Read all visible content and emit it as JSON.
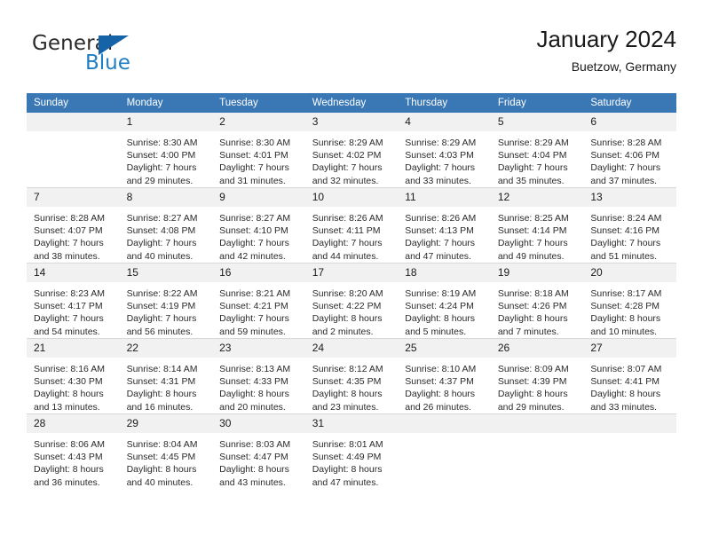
{
  "logo": {
    "word_top": "General",
    "word_bottom": "Blue",
    "accent_color": "#1763a8",
    "text_color": "#2b2b2b",
    "blue_text_color": "#1f7ec4"
  },
  "header": {
    "title": "January 2024",
    "subtitle": "Buetzow, Germany",
    "header_bg": "#3a77b5",
    "daynum_bg": "#f1f1f1"
  },
  "weekdays": [
    "Sunday",
    "Monday",
    "Tuesday",
    "Wednesday",
    "Thursday",
    "Friday",
    "Saturday"
  ],
  "labels": {
    "sunrise": "Sunrise:",
    "sunset": "Sunset:",
    "daylight": "Daylight:"
  },
  "weeks": [
    [
      {
        "day": "",
        "blank": true
      },
      {
        "day": "1",
        "l1": "Sunrise: 8:30 AM",
        "l2": "Sunset: 4:00 PM",
        "l3": "Daylight: 7 hours",
        "l4": "and 29 minutes."
      },
      {
        "day": "2",
        "l1": "Sunrise: 8:30 AM",
        "l2": "Sunset: 4:01 PM",
        "l3": "Daylight: 7 hours",
        "l4": "and 31 minutes."
      },
      {
        "day": "3",
        "l1": "Sunrise: 8:29 AM",
        "l2": "Sunset: 4:02 PM",
        "l3": "Daylight: 7 hours",
        "l4": "and 32 minutes."
      },
      {
        "day": "4",
        "l1": "Sunrise: 8:29 AM",
        "l2": "Sunset: 4:03 PM",
        "l3": "Daylight: 7 hours",
        "l4": "and 33 minutes."
      },
      {
        "day": "5",
        "l1": "Sunrise: 8:29 AM",
        "l2": "Sunset: 4:04 PM",
        "l3": "Daylight: 7 hours",
        "l4": "and 35 minutes."
      },
      {
        "day": "6",
        "l1": "Sunrise: 8:28 AM",
        "l2": "Sunset: 4:06 PM",
        "l3": "Daylight: 7 hours",
        "l4": "and 37 minutes."
      }
    ],
    [
      {
        "day": "7",
        "l1": "Sunrise: 8:28 AM",
        "l2": "Sunset: 4:07 PM",
        "l3": "Daylight: 7 hours",
        "l4": "and 38 minutes."
      },
      {
        "day": "8",
        "l1": "Sunrise: 8:27 AM",
        "l2": "Sunset: 4:08 PM",
        "l3": "Daylight: 7 hours",
        "l4": "and 40 minutes."
      },
      {
        "day": "9",
        "l1": "Sunrise: 8:27 AM",
        "l2": "Sunset: 4:10 PM",
        "l3": "Daylight: 7 hours",
        "l4": "and 42 minutes."
      },
      {
        "day": "10",
        "l1": "Sunrise: 8:26 AM",
        "l2": "Sunset: 4:11 PM",
        "l3": "Daylight: 7 hours",
        "l4": "and 44 minutes."
      },
      {
        "day": "11",
        "l1": "Sunrise: 8:26 AM",
        "l2": "Sunset: 4:13 PM",
        "l3": "Daylight: 7 hours",
        "l4": "and 47 minutes."
      },
      {
        "day": "12",
        "l1": "Sunrise: 8:25 AM",
        "l2": "Sunset: 4:14 PM",
        "l3": "Daylight: 7 hours",
        "l4": "and 49 minutes."
      },
      {
        "day": "13",
        "l1": "Sunrise: 8:24 AM",
        "l2": "Sunset: 4:16 PM",
        "l3": "Daylight: 7 hours",
        "l4": "and 51 minutes."
      }
    ],
    [
      {
        "day": "14",
        "l1": "Sunrise: 8:23 AM",
        "l2": "Sunset: 4:17 PM",
        "l3": "Daylight: 7 hours",
        "l4": "and 54 minutes."
      },
      {
        "day": "15",
        "l1": "Sunrise: 8:22 AM",
        "l2": "Sunset: 4:19 PM",
        "l3": "Daylight: 7 hours",
        "l4": "and 56 minutes."
      },
      {
        "day": "16",
        "l1": "Sunrise: 8:21 AM",
        "l2": "Sunset: 4:21 PM",
        "l3": "Daylight: 7 hours",
        "l4": "and 59 minutes."
      },
      {
        "day": "17",
        "l1": "Sunrise: 8:20 AM",
        "l2": "Sunset: 4:22 PM",
        "l3": "Daylight: 8 hours",
        "l4": "and 2 minutes."
      },
      {
        "day": "18",
        "l1": "Sunrise: 8:19 AM",
        "l2": "Sunset: 4:24 PM",
        "l3": "Daylight: 8 hours",
        "l4": "and 5 minutes."
      },
      {
        "day": "19",
        "l1": "Sunrise: 8:18 AM",
        "l2": "Sunset: 4:26 PM",
        "l3": "Daylight: 8 hours",
        "l4": "and 7 minutes."
      },
      {
        "day": "20",
        "l1": "Sunrise: 8:17 AM",
        "l2": "Sunset: 4:28 PM",
        "l3": "Daylight: 8 hours",
        "l4": "and 10 minutes."
      }
    ],
    [
      {
        "day": "21",
        "l1": "Sunrise: 8:16 AM",
        "l2": "Sunset: 4:30 PM",
        "l3": "Daylight: 8 hours",
        "l4": "and 13 minutes."
      },
      {
        "day": "22",
        "l1": "Sunrise: 8:14 AM",
        "l2": "Sunset: 4:31 PM",
        "l3": "Daylight: 8 hours",
        "l4": "and 16 minutes."
      },
      {
        "day": "23",
        "l1": "Sunrise: 8:13 AM",
        "l2": "Sunset: 4:33 PM",
        "l3": "Daylight: 8 hours",
        "l4": "and 20 minutes."
      },
      {
        "day": "24",
        "l1": "Sunrise: 8:12 AM",
        "l2": "Sunset: 4:35 PM",
        "l3": "Daylight: 8 hours",
        "l4": "and 23 minutes."
      },
      {
        "day": "25",
        "l1": "Sunrise: 8:10 AM",
        "l2": "Sunset: 4:37 PM",
        "l3": "Daylight: 8 hours",
        "l4": "and 26 minutes."
      },
      {
        "day": "26",
        "l1": "Sunrise: 8:09 AM",
        "l2": "Sunset: 4:39 PM",
        "l3": "Daylight: 8 hours",
        "l4": "and 29 minutes."
      },
      {
        "day": "27",
        "l1": "Sunrise: 8:07 AM",
        "l2": "Sunset: 4:41 PM",
        "l3": "Daylight: 8 hours",
        "l4": "and 33 minutes."
      }
    ],
    [
      {
        "day": "28",
        "l1": "Sunrise: 8:06 AM",
        "l2": "Sunset: 4:43 PM",
        "l3": "Daylight: 8 hours",
        "l4": "and 36 minutes."
      },
      {
        "day": "29",
        "l1": "Sunrise: 8:04 AM",
        "l2": "Sunset: 4:45 PM",
        "l3": "Daylight: 8 hours",
        "l4": "and 40 minutes."
      },
      {
        "day": "30",
        "l1": "Sunrise: 8:03 AM",
        "l2": "Sunset: 4:47 PM",
        "l3": "Daylight: 8 hours",
        "l4": "and 43 minutes."
      },
      {
        "day": "31",
        "l1": "Sunrise: 8:01 AM",
        "l2": "Sunset: 4:49 PM",
        "l3": "Daylight: 8 hours",
        "l4": "and 47 minutes."
      },
      {
        "day": "",
        "blank": true
      },
      {
        "day": "",
        "blank": true
      },
      {
        "day": "",
        "blank": true
      }
    ]
  ]
}
